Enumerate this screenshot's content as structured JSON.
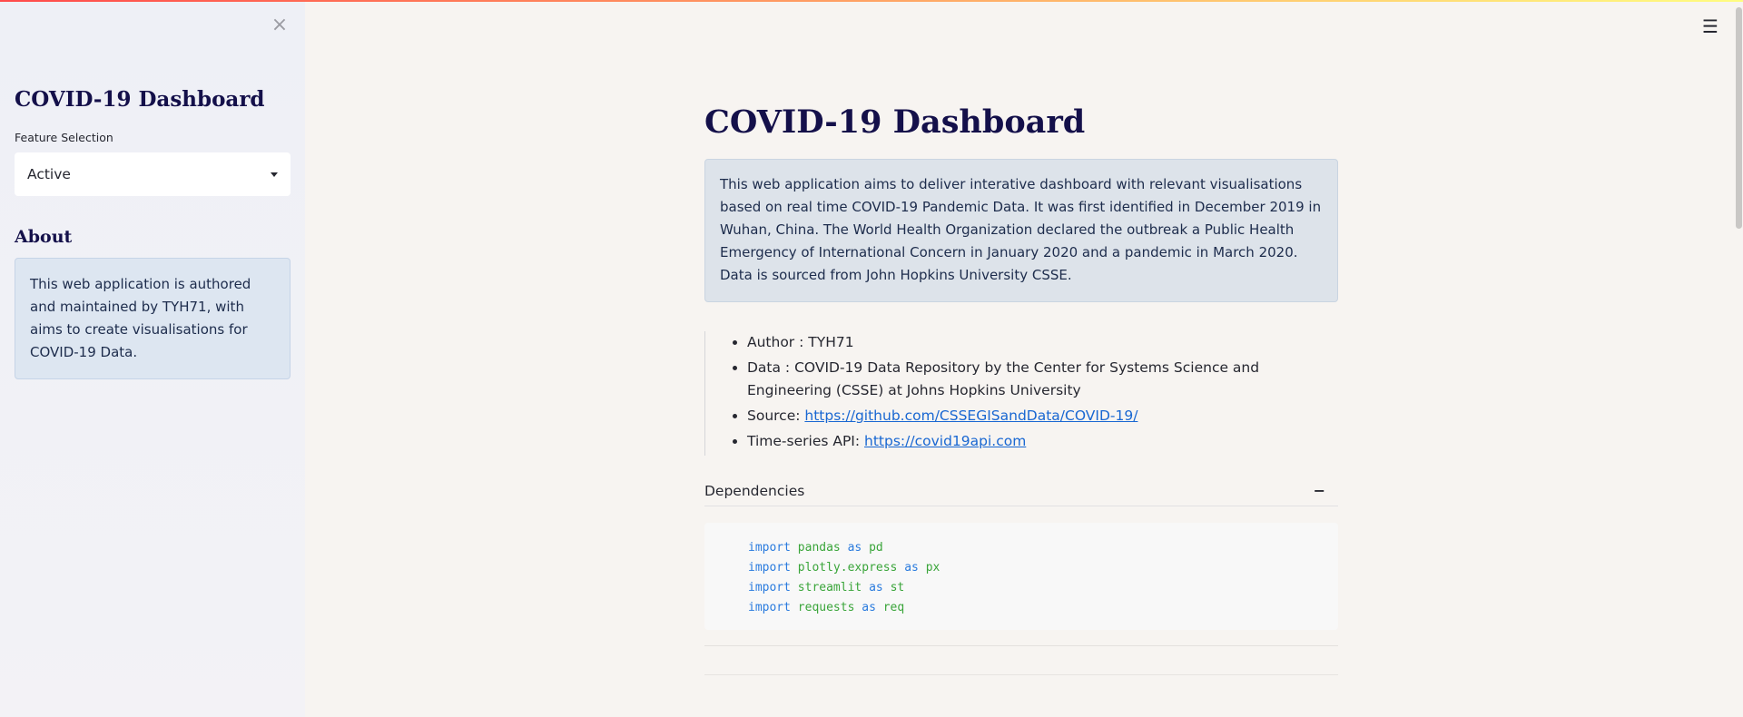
{
  "sidebar": {
    "close_glyph": "×",
    "title": "COVID-19 Dashboard",
    "feature_label": "Feature Selection",
    "feature_selected": "Active",
    "about_title": "About",
    "about_text": "This web application is authored and maintained by TYH71, with aims to create visualisations for COVID-19 Data."
  },
  "header": {
    "menu_glyph": "☰",
    "menu_icon": "hamburger-menu-icon"
  },
  "main": {
    "title": "COVID-19 Dashboard",
    "intro": "This web application aims to deliver interative dashboard with relevant visualisations based on real time COVID-19 Pandemic Data. It was first identified in December 2019 in Wuhan, China. The World Health Organization declared the outbreak a Public Health Emergency of International Concern in January 2020 and a pandemic in March 2020. Data is sourced from John Hopkins University CSSE.",
    "bullets": {
      "author": "Author : TYH71",
      "data": "Data : COVID-19 Data Repository by the Center for Systems Science and Engineering (CSSE) at Johns Hopkins University",
      "source_prefix": "Source: ",
      "source_link": "https://github.com/CSSEGISandData/COVID-19/",
      "api_prefix": "Time-series API: ",
      "api_link": "https://covid19api.com"
    },
    "expander": {
      "label": "Dependencies",
      "toggle_glyph": "−"
    },
    "code": [
      {
        "keyword": "import",
        "module": "pandas",
        "as": "as",
        "alias": "pd"
      },
      {
        "keyword": "import",
        "module": "plotly.express",
        "as": "as",
        "alias": "px"
      },
      {
        "keyword": "import",
        "module": "streamlit",
        "as": "as",
        "alias": "st"
      },
      {
        "keyword": "import",
        "module": "requests",
        "as": "as",
        "alias": "req"
      }
    ]
  },
  "colors": {
    "title": "#14104a",
    "link": "#1967d2",
    "code_keyword": "#2a7bde",
    "code_module": "#3aa53a"
  }
}
